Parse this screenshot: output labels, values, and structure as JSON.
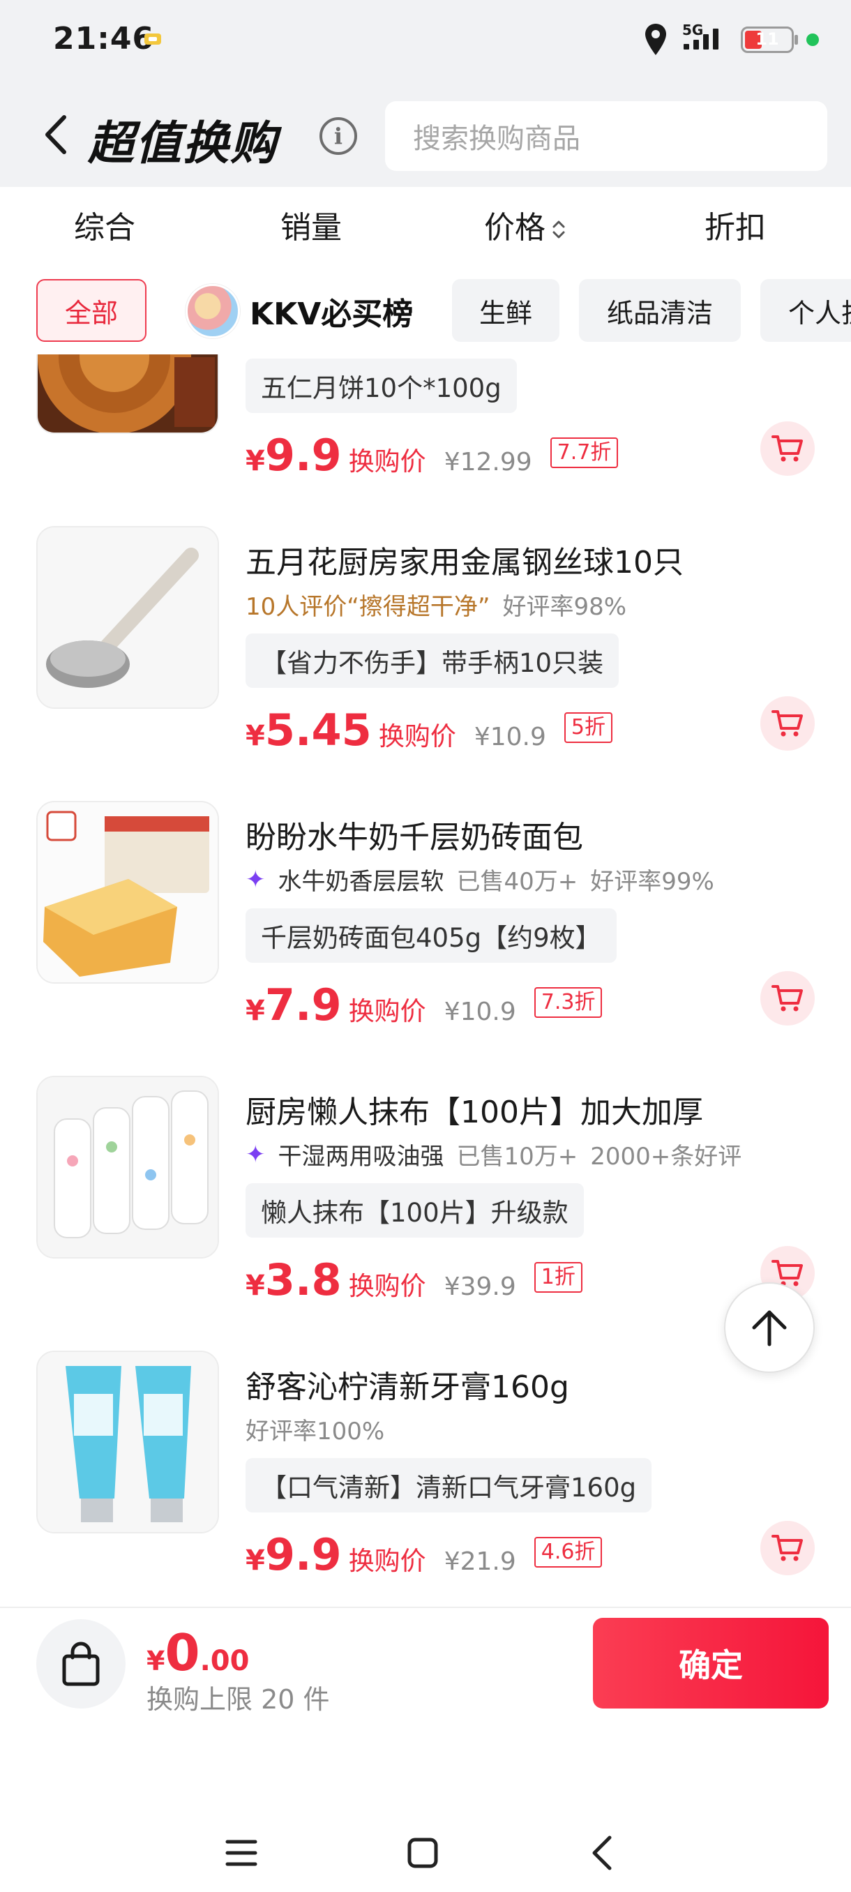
{
  "status_bar": {
    "time": "21:46",
    "network": "5G",
    "battery": "11"
  },
  "header": {
    "title": "超值换购",
    "info_icon": "info-icon",
    "search_placeholder": "搜索换购商品"
  },
  "sort_tabs": [
    {
      "label": "综合"
    },
    {
      "label": "销量"
    },
    {
      "label": "价格"
    },
    {
      "label": "折扣"
    }
  ],
  "chips": [
    {
      "label": "全部",
      "active": true
    },
    {
      "label": "KKV必买榜"
    },
    {
      "label": "生鲜"
    },
    {
      "label": "纸品清洁"
    },
    {
      "label": "个人护"
    }
  ],
  "products": [
    {
      "name": "",
      "tag": "五仁月饼10个*100g",
      "currency": "¥",
      "price": "9.9",
      "price_label": "换购价",
      "original": "¥12.99",
      "discount": "7.7折"
    },
    {
      "name": "五月花厨房家用金属钢丝球10只",
      "review": "10人评价“擦得超干净”",
      "rating": "好评率98%",
      "tag": "【省力不伤手】带手柄10只装",
      "currency": "¥",
      "price": "5.45",
      "price_label": "换购价",
      "original": "¥10.9",
      "discount": "5折"
    },
    {
      "name": "盼盼水牛奶千层奶砖面包",
      "highlight": "水牛奶香层层软",
      "sold": "已售40万+",
      "rating": "好评率99%",
      "tag": "千层奶砖面包405g【约9枚】",
      "currency": "¥",
      "price": "7.9",
      "price_label": "换购价",
      "original": "¥10.9",
      "discount": "7.3折"
    },
    {
      "name": "厨房懒人抹布【100片】加大加厚",
      "highlight": "干湿两用吸油强",
      "sold": "已售10万+",
      "rating": "2000+条好评",
      "tag": "懒人抹布【100片】升级款",
      "currency": "¥",
      "price": "3.8",
      "price_label": "换购价",
      "original": "¥39.9",
      "discount": "1折"
    },
    {
      "name": "舒客沁柠清新牙膏160g",
      "rating": "好评率100%",
      "tag": "【口气清新】清新口气牙膏160g",
      "currency": "¥",
      "price": "9.9",
      "price_label": "换购价",
      "original": "¥21.9",
      "discount": "4.6折"
    }
  ],
  "bottom": {
    "currency": "¥",
    "total_int": "0",
    "total_dec": ".00",
    "limit_text": "换购上限 20 件",
    "confirm_label": "确定"
  },
  "colors": {
    "accent": "#ee2d40",
    "review": "#b7762a",
    "highlight_icon": "#7b3ff2"
  }
}
